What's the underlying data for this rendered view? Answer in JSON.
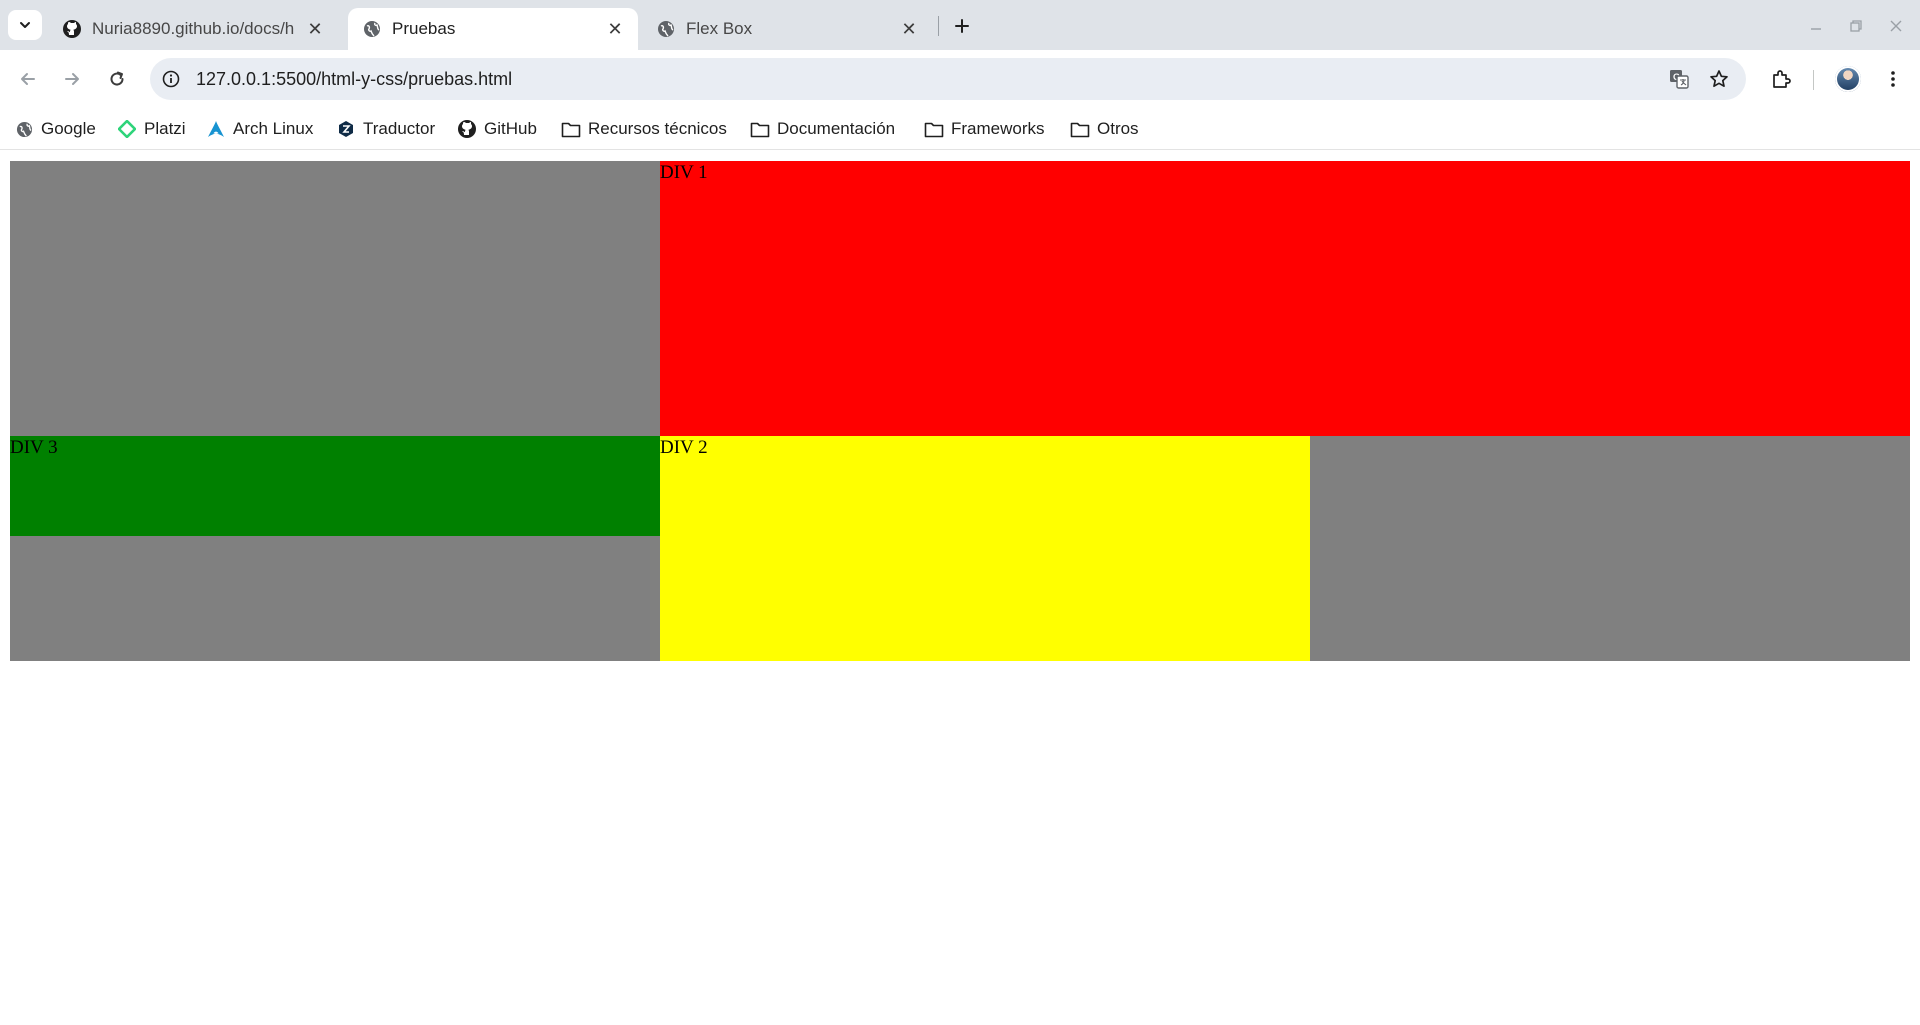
{
  "browser": {
    "tabs": [
      {
        "title": "Nuria8890.github.io/docs/h",
        "icon": "github-icon",
        "active": false
      },
      {
        "title": "Pruebas",
        "icon": "globe-icon",
        "active": true
      },
      {
        "title": "Flex Box",
        "icon": "globe-icon",
        "active": false
      }
    ],
    "address": {
      "url": "127.0.0.1:5500/html-y-css/pruebas.html"
    },
    "bookmarks": [
      {
        "label": "Google",
        "icon": "globe-icon"
      },
      {
        "label": "Platzi",
        "icon": "platzi-icon"
      },
      {
        "label": "Arch Linux",
        "icon": "arch-linux-icon"
      },
      {
        "label": "Traductor",
        "icon": "translator-icon"
      },
      {
        "label": "GitHub",
        "icon": "github-icon"
      },
      {
        "label": "Recursos técnicos",
        "icon": "folder-icon"
      },
      {
        "label": "Documentación",
        "icon": "folder-icon"
      },
      {
        "label": "Frameworks",
        "icon": "folder-icon"
      },
      {
        "label": "Otros",
        "icon": "folder-icon"
      }
    ]
  },
  "page": {
    "colors": {
      "container": "#808080",
      "div1": "#ff0000",
      "div2": "#ffff00",
      "div3": "#008000"
    },
    "divs": {
      "div1": "DIV 1",
      "div2": "DIV 2",
      "div3": "DIV 3"
    }
  }
}
